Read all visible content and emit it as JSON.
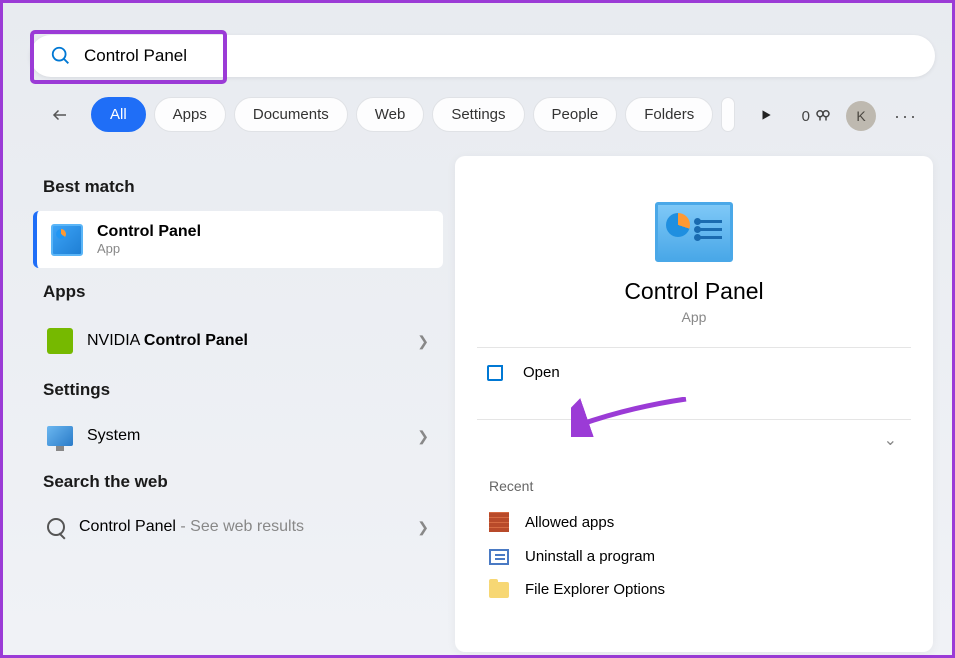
{
  "search": {
    "value": "Control Panel"
  },
  "tabs": {
    "all": "All",
    "apps": "Apps",
    "documents": "Documents",
    "web": "Web",
    "settings": "Settings",
    "people": "People",
    "folders": "Folders"
  },
  "rewards": {
    "count": "0"
  },
  "avatar": {
    "initial": "K"
  },
  "sections": {
    "best_match": "Best match",
    "apps": "Apps",
    "settings": "Settings",
    "web": "Search the web"
  },
  "best_match": {
    "title": "Control Panel",
    "subtitle": "App"
  },
  "apps_list": {
    "nvidia_prefix": "NVIDIA ",
    "nvidia_bold": "Control Panel"
  },
  "settings_list": {
    "system": "System"
  },
  "web_list": {
    "query": "Control Panel",
    "suffix": " - See web results"
  },
  "detail": {
    "title": "Control Panel",
    "subtitle": "App",
    "open": "Open",
    "recent_label": "Recent",
    "recent": {
      "allowed": "Allowed apps",
      "uninstall": "Uninstall a program",
      "explorer": "File Explorer Options"
    }
  }
}
